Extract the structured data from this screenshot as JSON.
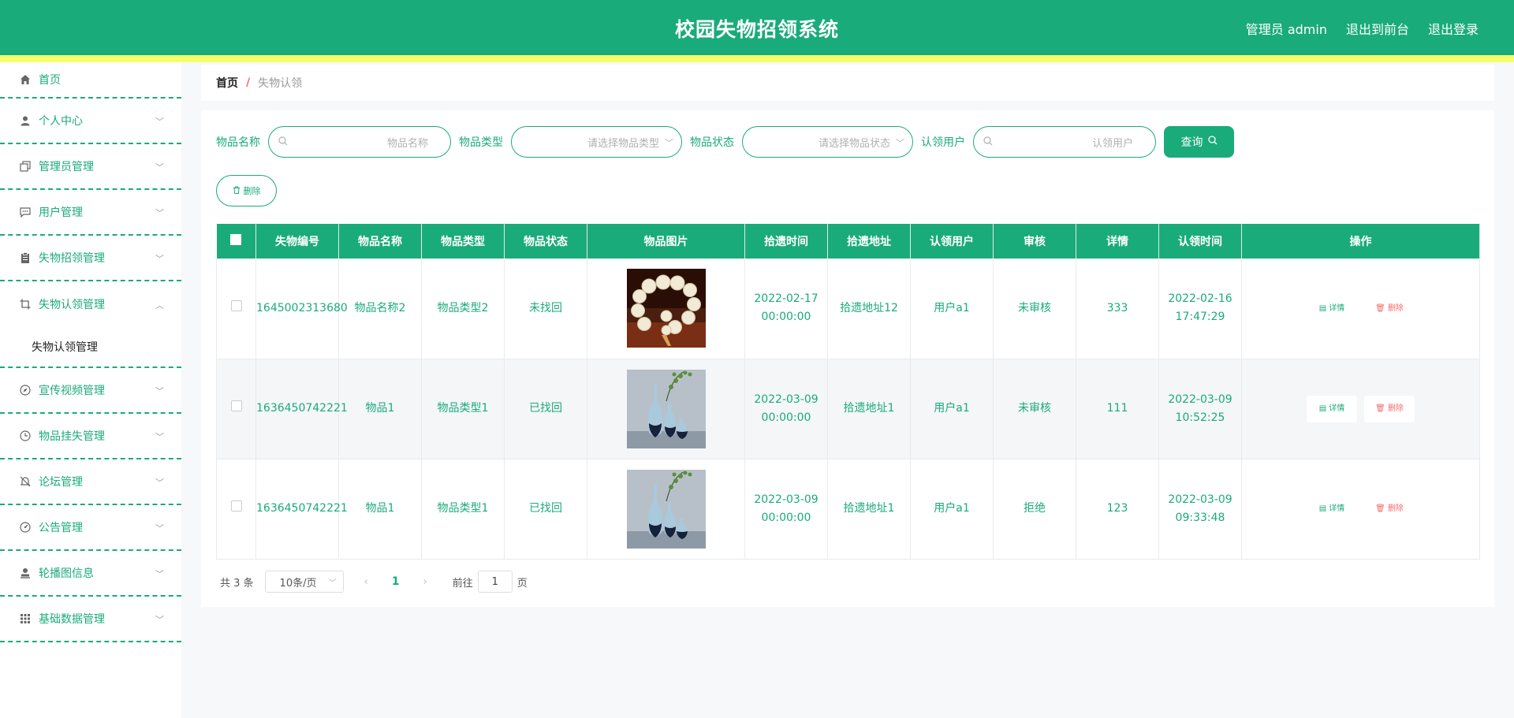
{
  "header": {
    "title": "校园失物招领系统",
    "admin_label": "管理员 admin",
    "to_front_label": "退出到前台",
    "logout_label": "退出登录"
  },
  "sidebar": {
    "items": [
      {
        "label": "首页",
        "icon": "home-icon"
      },
      {
        "label": "个人中心",
        "icon": "user-icon"
      },
      {
        "label": "管理员管理",
        "icon": "copy-icon"
      },
      {
        "label": "用户管理",
        "icon": "chat-icon"
      },
      {
        "label": "失物招领管理",
        "icon": "clipboard-icon"
      },
      {
        "label": "失物认领管理",
        "icon": "crop-icon",
        "sub": "失物认领管理"
      },
      {
        "label": "宣传视频管理",
        "icon": "compass-icon"
      },
      {
        "label": "物品挂失管理",
        "icon": "clock-icon"
      },
      {
        "label": "论坛管理",
        "icon": "bell-off-icon"
      },
      {
        "label": "公告管理",
        "icon": "gauge-icon"
      },
      {
        "label": "轮播图信息",
        "icon": "person-stamp-icon"
      },
      {
        "label": "基础数据管理",
        "icon": "grid-icon"
      }
    ]
  },
  "breadcrumb": {
    "home": "首页",
    "sep": "/",
    "current": "失物认领"
  },
  "filters": {
    "name_label": "物品名称",
    "name_placeholder": "物品名称",
    "type_label": "物品类型",
    "type_placeholder": "请选择物品类型",
    "status_label": "物品状态",
    "status_placeholder": "请选择物品状态",
    "user_label": "认领用户",
    "user_placeholder": "认领用户",
    "query_label": "查询",
    "delete_label": "删除"
  },
  "table": {
    "headers": [
      "失物编号",
      "物品名称",
      "物品类型",
      "物品状态",
      "物品图片",
      "拾遗时间",
      "拾遗地址",
      "认领用户",
      "审核",
      "详情",
      "认领时间",
      "操作"
    ],
    "rows": [
      {
        "code": "1645002313680",
        "name": "物品名称2",
        "type": "物品类型2",
        "status": "未找回",
        "image": "beads",
        "pick_time": "2022-02-17 00:00:00",
        "address": "拾遗地址12",
        "user": "用户a1",
        "review": "未审核",
        "detail": "333",
        "claim_time": "2022-02-16 17:47:29"
      },
      {
        "code": "1636450742221",
        "name": "物品1",
        "type": "物品类型1",
        "status": "已找回",
        "image": "vases",
        "pick_time": "2022-03-09 00:00:00",
        "address": "拾遗地址1",
        "user": "用户a1",
        "review": "未审核",
        "detail": "111",
        "claim_time": "2022-03-09 10:52:25"
      },
      {
        "code": "1636450742221",
        "name": "物品1",
        "type": "物品类型1",
        "status": "已找回",
        "image": "vases",
        "pick_time": "2022-03-09 00:00:00",
        "address": "拾遗地址1",
        "user": "用户a1",
        "review": "拒绝",
        "detail": "123",
        "claim_time": "2022-03-09 09:33:48"
      }
    ],
    "op_detail": "详情",
    "op_delete": "删除"
  },
  "pagination": {
    "total": "共 3 条",
    "page_size": "10条/页",
    "current_page": "1",
    "goto_label": "前往",
    "goto_value": "1",
    "page_suffix": "页"
  },
  "colors": {
    "primary": "#1aab7a",
    "stripe": "#f6ff6a",
    "danger": "#f56c6c"
  }
}
